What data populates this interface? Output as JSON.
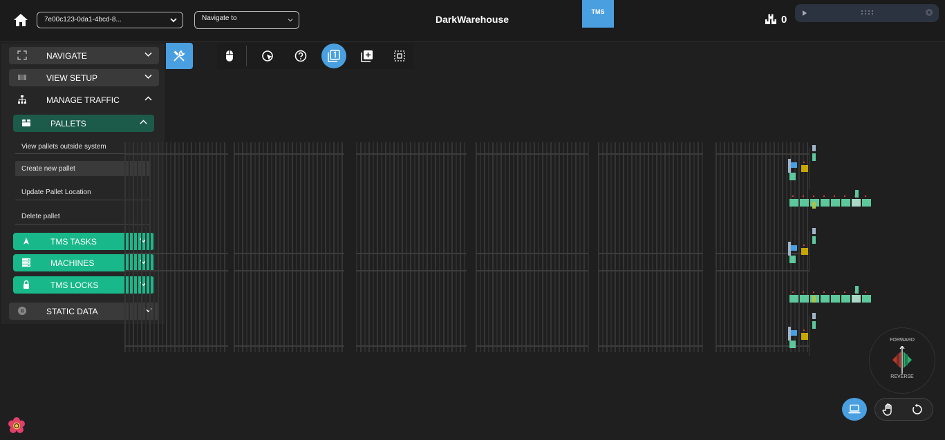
{
  "header": {
    "session_select": "7e00c123-0da1-4bcd-8...",
    "navigate_select": "Navigate to",
    "title": "DarkWarehouse",
    "tms_tab": "TMS",
    "package_count": "0"
  },
  "panel": {
    "navigate": "NAVIGATE",
    "view_setup": "VIEW SETUP",
    "manage_traffic": "MANAGE TRAFFIC",
    "pallets": "PALLETS",
    "pallet_items": [
      "View pallets outside system",
      "Create new pallet",
      "Update Pallet Location",
      "Delete pallet"
    ],
    "tms_tasks": "TMS TASKS",
    "machines": "MACHINES",
    "tms_locks": "TMS LOCKS",
    "static_data": "STATIC DATA"
  },
  "direction": {
    "forward": "FORWARD",
    "reverse": "REVERSE"
  },
  "colors": {
    "accent": "#4a9fe0",
    "green": "#19b88a",
    "dark_green": "#1c5a49"
  }
}
